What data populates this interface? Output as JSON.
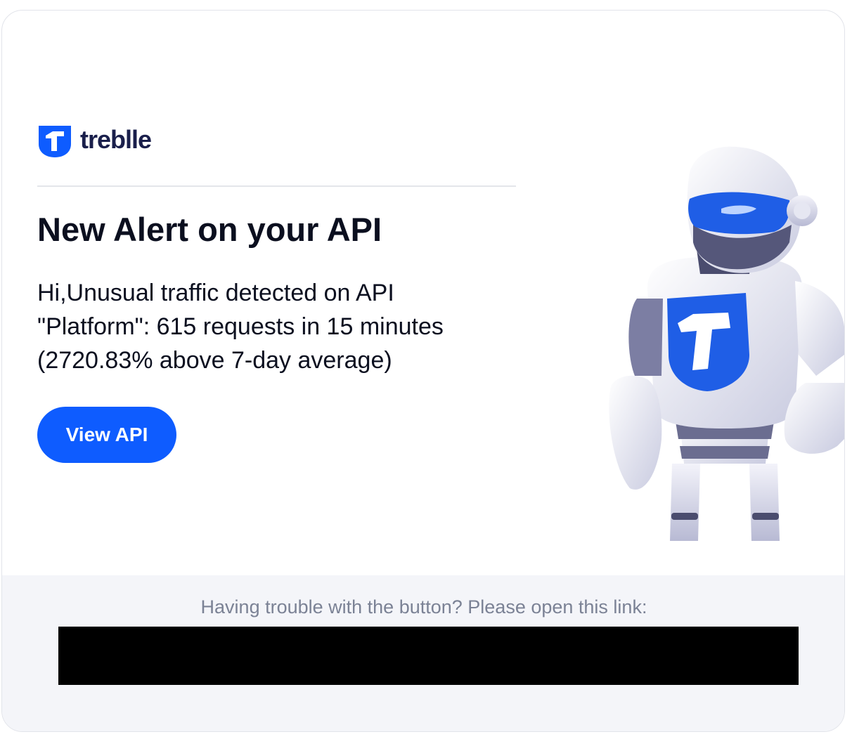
{
  "brand": {
    "name": "treblle",
    "logo_icon": "treblle-shield-icon",
    "primary_color": "#0e5cff"
  },
  "email": {
    "title": "New Alert on your API",
    "message": "Hi,Unusual traffic detected on API \"Platform\": 615 requests in 15 minutes (2720.83% above 7-day average)",
    "button_label": "View API",
    "illustration": "treblle-robot-mascot"
  },
  "footer": {
    "help_text": "Having trouble with the button? Please open this link:",
    "link_redacted": true
  }
}
